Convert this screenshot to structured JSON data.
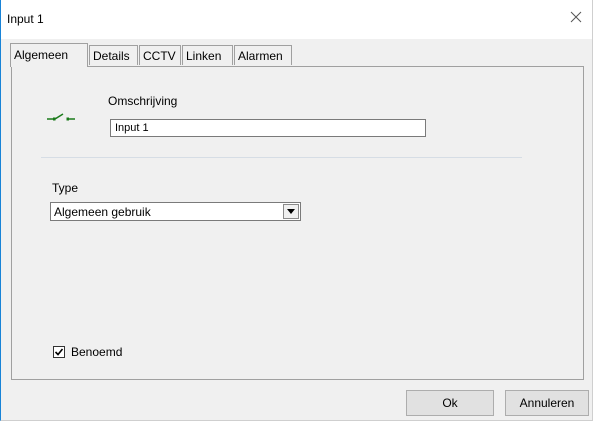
{
  "window": {
    "title": "Input 1"
  },
  "tabs": [
    {
      "label": "Algemeen",
      "active": true
    },
    {
      "label": "Details"
    },
    {
      "label": "CCTV"
    },
    {
      "label": "Linken"
    },
    {
      "label": "Alarmen"
    }
  ],
  "general": {
    "description_label": "Omschrijving",
    "description_value": "Input 1",
    "type_label": "Type",
    "type_value": "Algemeen gebruik",
    "named_label": "Benoemd",
    "named_checked": true
  },
  "buttons": {
    "ok": "Ok",
    "cancel": "Annuleren"
  },
  "colors": {
    "accent_border": "#1883d7",
    "icon_green": "#1a7a1a"
  }
}
